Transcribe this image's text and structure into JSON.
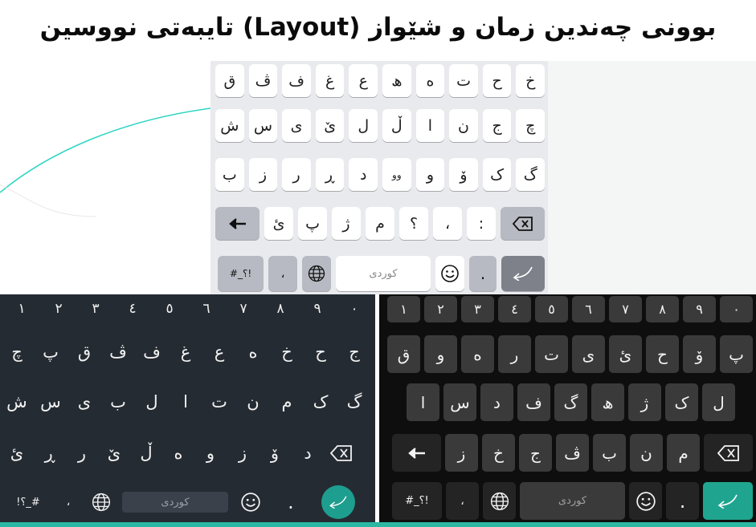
{
  "title": "بوونی چەندین زمان و شێواز (Layout) تایبەتی نووسین",
  "light_keyboard": {
    "rows": [
      [
        "خ",
        "ح",
        "ت",
        "ه",
        "ھ",
        "ع",
        "غ",
        "ف",
        "ڤ",
        "ق"
      ],
      [
        "چ",
        "ج",
        "ن",
        "ا",
        "ڵ",
        "ل",
        "ێ",
        "ی",
        "س",
        "ش"
      ],
      [
        "گ",
        "ک",
        "ۆ",
        "و",
        "وو",
        "د",
        "ڕ",
        "ر",
        "ز",
        "ب"
      ],
      [
        "ئ",
        "پ",
        "ژ",
        "م",
        "؟",
        "،",
        ":"
      ]
    ],
    "bottom": {
      "symbols": "!؟_#",
      "comma": "،",
      "space": "کوردی",
      "period": "."
    }
  },
  "dark_keyboard_1": {
    "numbers": [
      "١",
      "٢",
      "٣",
      "٤",
      "٥",
      "٦",
      "٧",
      "٨",
      "٩",
      "٠"
    ],
    "rows": [
      [
        "ج",
        "ح",
        "خ",
        "ه",
        "ع",
        "غ",
        "ف",
        "ڤ",
        "ق",
        "پ",
        "چ"
      ],
      [
        "گ",
        "ک",
        "م",
        "ن",
        "ت",
        "ا",
        "ل",
        "ب",
        "ی",
        "س",
        "ش"
      ],
      [
        "د",
        "ۆ",
        "ز",
        "و",
        "ه",
        "ڵ",
        "ێ",
        "ر",
        "ڕ",
        "ئ"
      ]
    ],
    "bottom": {
      "symbols": "!؟_#",
      "comma": "،",
      "space": "کوردی",
      "period": "."
    }
  },
  "dark_keyboard_2": {
    "numbers": [
      "١",
      "٢",
      "٣",
      "٤",
      "٥",
      "٦",
      "٧",
      "٨",
      "٩",
      "٠"
    ],
    "rows": [
      [
        "پ",
        "ۆ",
        "ح",
        "ئ",
        "ی",
        "ت",
        "ر",
        "ە",
        "و",
        "ق"
      ],
      [
        "ل",
        "ک",
        "ژ",
        "ھ",
        "گ",
        "ف",
        "د",
        "س",
        "ا"
      ],
      [
        "م",
        "ن",
        "ب",
        "ڤ",
        "ج",
        "خ",
        "ز"
      ]
    ],
    "bottom": {
      "symbols": "!؟_#",
      "comma": "،",
      "space": "کوردی",
      "period": "."
    }
  },
  "colors": {
    "accent_teal": "#1fa58f",
    "dark1_bg": "#252b33",
    "dark2_bg": "#0e0e0e",
    "light_bg": "#e9eaee"
  }
}
